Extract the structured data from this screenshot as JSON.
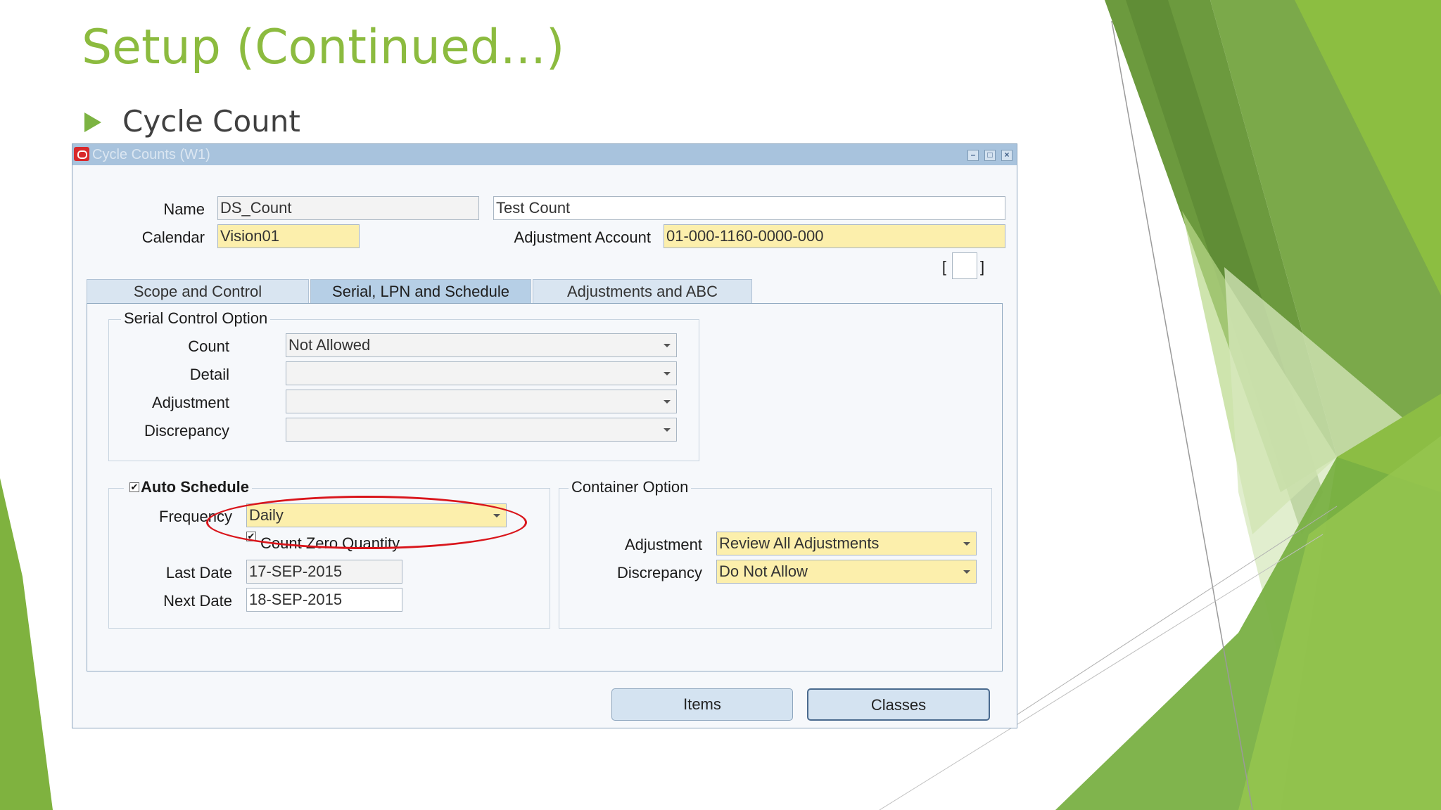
{
  "slide": {
    "title": "Setup (Continued...)",
    "bullet": "Cycle Count"
  },
  "window": {
    "title": "Cycle Counts (W1)",
    "minimize": "–",
    "maximize": "□",
    "close": "×"
  },
  "header": {
    "name_label": "Name",
    "name_value": "DS_Count",
    "description_value": "Test Count",
    "calendar_label": "Calendar",
    "calendar_value": "Vision01",
    "adjustment_account_label": "Adjustment Account",
    "adjustment_account_value": "01-000-1160-0000-000",
    "dff_left": "[",
    "dff_right": "]"
  },
  "tabs": [
    {
      "label": "Scope and Control",
      "active": false
    },
    {
      "label": "Serial, LPN and Schedule",
      "active": true
    },
    {
      "label": "Adjustments and ABC",
      "active": false
    }
  ],
  "serial_control": {
    "title": "Serial Control Option",
    "count_label": "Count",
    "count_value": "Not Allowed",
    "detail_label": "Detail",
    "detail_value": "",
    "adjustment_label": "Adjustment",
    "adjustment_value": "",
    "discrepancy_label": "Discrepancy",
    "discrepancy_value": ""
  },
  "auto_schedule": {
    "title": "Auto Schedule",
    "checked": true,
    "frequency_label": "Frequency",
    "frequency_value": "Daily",
    "count_zero_label": "Count Zero Quantity",
    "count_zero_checked": true,
    "last_date_label": "Last Date",
    "last_date_value": "17-SEP-2015",
    "next_date_label": "Next Date",
    "next_date_value": "18-SEP-2015"
  },
  "container_option": {
    "title": "Container Option",
    "adjustment_label": "Adjustment",
    "adjustment_value": "Review All Adjustments",
    "discrepancy_label": "Discrepancy",
    "discrepancy_value": "Do Not Allow"
  },
  "buttons": {
    "items": "Items",
    "classes": "Classes"
  },
  "colors": {
    "title_green": "#8cbb3f",
    "required_yellow": "#fcefac",
    "highlight_red": "#d9151b"
  }
}
